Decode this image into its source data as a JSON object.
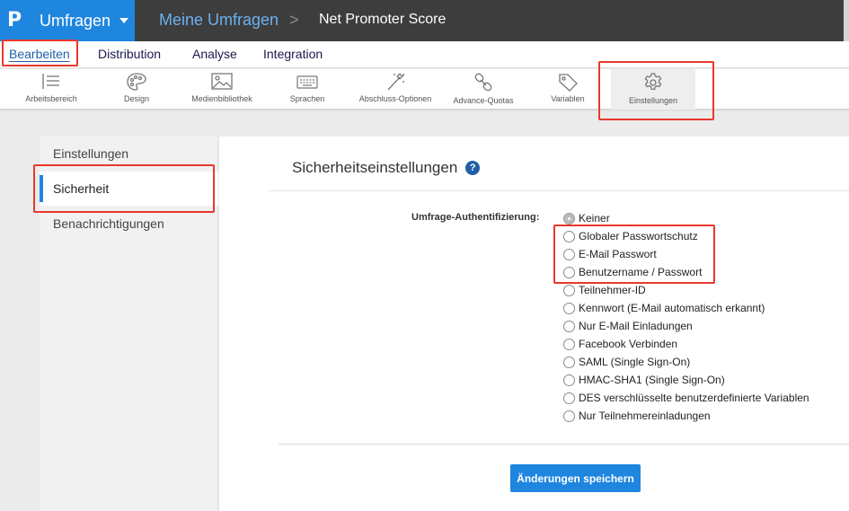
{
  "topbar": {
    "logo": "P",
    "app_name": "Umfragen",
    "breadcrumb_parent": "Meine Umfragen",
    "breadcrumb_separator": ">",
    "breadcrumb_current": "Net Promoter Score"
  },
  "tabs": [
    "Bearbeiten",
    "Distribution",
    "Analyse",
    "Integration"
  ],
  "toolbar": {
    "items": [
      {
        "label": "Arbeitsbereich",
        "icon": "workspace-list-icon"
      },
      {
        "label": "Design",
        "icon": "palette-icon"
      },
      {
        "label": "Medienbibliothek",
        "icon": "image-icon"
      },
      {
        "label": "Sprachen",
        "icon": "keyboard-icon"
      },
      {
        "label": "Abschluss-Optionen",
        "icon": "magic-wand-icon"
      },
      {
        "label": "Advance-Quotas",
        "icon": "chain-link-icon"
      },
      {
        "label": "Variablen",
        "icon": "tag-icon"
      },
      {
        "label": "Einstellungen",
        "icon": "gear-icon"
      }
    ]
  },
  "sidebar": {
    "items": [
      "Einstellungen",
      "Sicherheit",
      "Benachrichtigungen"
    ]
  },
  "main": {
    "title": "Sicherheitseinstellungen",
    "help": "?",
    "auth_label": "Umfrage-Authentifizierung:",
    "options": [
      "Keiner",
      "Globaler Passwortschutz",
      "E-Mail Passwort",
      "Benutzername / Passwort",
      "Teilnehmer-ID",
      "Kennwort (E-Mail automatisch erkannt)",
      "Nur E-Mail Einladungen",
      "Facebook Verbinden",
      "SAML (Single Sign-On)",
      "HMAC-SHA1 (Single Sign-On)",
      "DES verschlüsselte benutzerdefinierte Variablen",
      "Nur Teilnehmereinladungen"
    ],
    "selected_option": "Keiner",
    "save_label": "Änderungen speichern"
  },
  "colors": {
    "brand_blue": "#1f86df",
    "topbar_dark": "#3d3d3d",
    "highlight_red": "#e8392b"
  }
}
